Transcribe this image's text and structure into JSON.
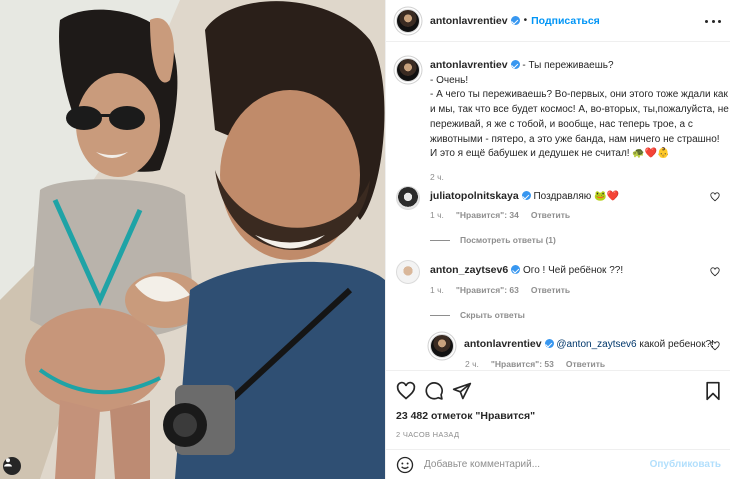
{
  "post": {
    "author": "antonlavrentiev",
    "follow_label": "Подписаться",
    "separator": "•",
    "caption_lines": [
      "- Ты переживаешь?",
      "- Очень!",
      "- А чего ты переживаешь? Во-первых, они этого тоже ждали как",
      "и мы, так что все будет космос! А, во-вторых, ты,пожалуйста, не",
      "переживай, я же с тобой, и вообще, нас теперь трое, а с",
      "животными - пятеро, а это уже банда, нам ничего не страшно!",
      "И это я ещё бабушек и дедушек не считал! 🐢❤️👶"
    ],
    "caption_time": "2 ч.",
    "likes": "23 482 отметок \"Нравится\"",
    "posted_ago": "2 ЧАСОВ НАЗАД"
  },
  "comments": [
    {
      "user": "juliatopolnitskaya",
      "text": "Поздравляю 🐸❤️",
      "time": "1 ч.",
      "likes": "\"Нравится\": 34",
      "reply_label": "Ответить",
      "replies_toggle": "Посмотреть ответы (1)"
    },
    {
      "user": "anton_zaytsev6",
      "text": "Ого ! Чей ребёнок ??!",
      "time": "1 ч.",
      "likes": "\"Нравится\": 63",
      "reply_label": "Ответить",
      "replies_toggle": "Скрыть ответы"
    }
  ],
  "reply": {
    "user": "antonlavrentiev",
    "mention": "@anton_zaytsev6",
    "text": " какой ребенок?!",
    "time": "2 ч.",
    "likes": "\"Нравится\": 53",
    "reply_label": "Ответить"
  },
  "add_comment": {
    "placeholder": "Добавьте комментарий...",
    "publish_label": "Опубликовать"
  },
  "icons": {
    "like": "heart-icon",
    "comment": "comment-icon",
    "share": "share-icon",
    "save": "bookmark-icon",
    "emoji": "emoji-icon",
    "more": "more-icon",
    "user_tag": "user-tag-icon"
  },
  "colors": {
    "accent": "#0095f6",
    "verified": "#3897f0",
    "muted": "#8e8e8e",
    "text": "#262626",
    "publish_disabled": "#b2dffc"
  }
}
